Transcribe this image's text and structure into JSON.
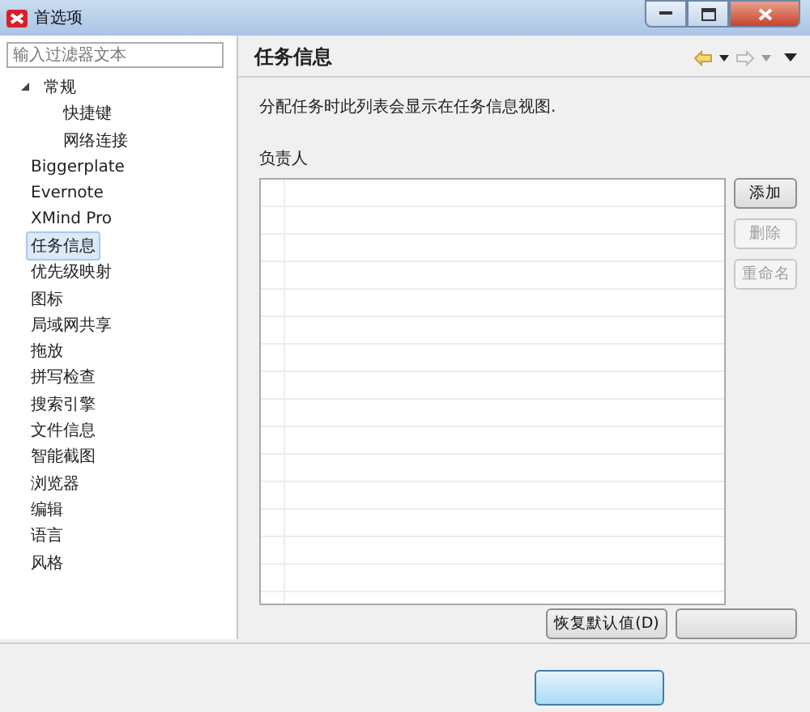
{
  "window": {
    "title": "首选项"
  },
  "filter": {
    "placeholder": "输入过滤器文本"
  },
  "tree": [
    {
      "label": "常规",
      "selected": false,
      "expanded": true,
      "children": [
        {
          "label": "快捷键",
          "selected": false
        },
        {
          "label": "网络连接",
          "selected": false
        }
      ]
    },
    {
      "label": "Biggerplate",
      "selected": false
    },
    {
      "label": "Evernote",
      "selected": false
    },
    {
      "label": "XMind Pro",
      "selected": false
    },
    {
      "label": "任务信息",
      "selected": true
    },
    {
      "label": "优先级映射",
      "selected": false
    },
    {
      "label": "图标",
      "selected": false
    },
    {
      "label": "局域网共享",
      "selected": false
    },
    {
      "label": "拖放",
      "selected": false
    },
    {
      "label": "拼写检查",
      "selected": false
    },
    {
      "label": "搜索引擎",
      "selected": false
    },
    {
      "label": "文件信息",
      "selected": false
    },
    {
      "label": "智能截图",
      "selected": false
    },
    {
      "label": "浏览器",
      "selected": false
    },
    {
      "label": "编辑",
      "selected": false
    },
    {
      "label": "语言",
      "selected": false
    },
    {
      "label": "风格",
      "selected": false
    }
  ],
  "page": {
    "title": "任务信息",
    "description": "分配任务时此列表会显示在任务信息视图.",
    "list_label": "负责人",
    "side_buttons": [
      {
        "label": "添加",
        "disabled": false
      },
      {
        "label": "删除",
        "disabled": true
      },
      {
        "label": "重命名",
        "disabled": true
      }
    ],
    "restore_button": "恢复默认值(D)"
  }
}
